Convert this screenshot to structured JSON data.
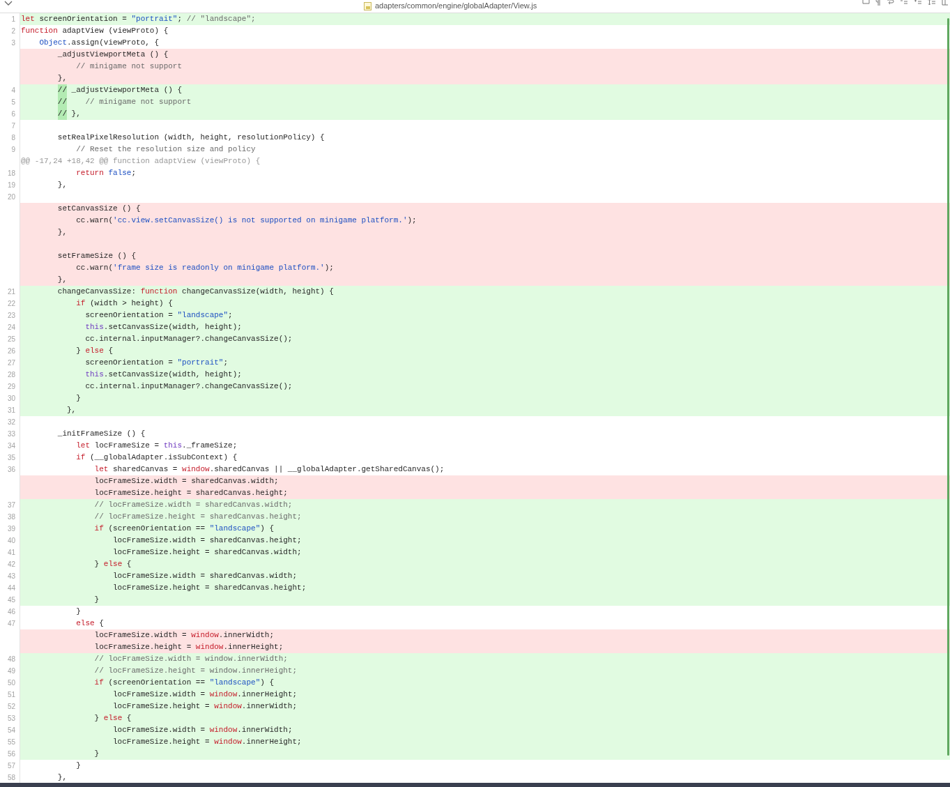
{
  "header": {
    "file_path": "adapters/common/engine/globalAdapter/View.js"
  },
  "lines": [
    {
      "kind": "added",
      "number": "1",
      "tokens": [
        {
          "kind": "keyword",
          "text": "let"
        },
        {
          "kind": "plain",
          "text": " screenOrientation = "
        },
        {
          "kind": "string",
          "text": "\"portrait\""
        },
        {
          "kind": "plain",
          "text": "; "
        },
        {
          "kind": "comment",
          "text": "// \"landscape\";"
        }
      ]
    },
    {
      "kind": "context",
      "number": "2",
      "tokens": [
        {
          "kind": "keyword",
          "text": "function"
        },
        {
          "kind": "plain",
          "text": " adaptView (viewProto) {"
        }
      ]
    },
    {
      "kind": "context",
      "number": "3",
      "tokens": [
        {
          "kind": "builtin",
          "text": "    Object"
        },
        {
          "kind": "plain",
          "text": ".assign(viewProto, {"
        }
      ]
    },
    {
      "kind": "removed",
      "tokens": [
        {
          "kind": "plain",
          "text": "        _adjustViewportMeta () {"
        }
      ]
    },
    {
      "kind": "removed",
      "tokens": [
        {
          "kind": "comment",
          "text": "            // minigame not support"
        }
      ]
    },
    {
      "kind": "removed",
      "tokens": [
        {
          "kind": "plain",
          "text": "        },"
        }
      ]
    },
    {
      "kind": "added",
      "number": "4",
      "tokens": [
        {
          "kind": "marked",
          "text": "        //"
        },
        {
          "kind": "plain",
          "text": " _adjustViewportMeta () {"
        }
      ]
    },
    {
      "kind": "added",
      "number": "5",
      "tokens": [
        {
          "kind": "marked",
          "text": "        //"
        },
        {
          "kind": "comment",
          "text": "    // minigame not support"
        }
      ]
    },
    {
      "kind": "added",
      "number": "6",
      "tokens": [
        {
          "kind": "marked",
          "text": "        //"
        },
        {
          "kind": "plain",
          "text": " },"
        }
      ]
    },
    {
      "kind": "context",
      "number": "7"
    },
    {
      "kind": "context",
      "number": "8",
      "tokens": [
        {
          "kind": "plain",
          "text": "        setRealPixelResolution (width, height, resolutionPolicy) {"
        }
      ]
    },
    {
      "kind": "context",
      "number": "9",
      "tokens": [
        {
          "kind": "comment",
          "text": "            // Reset the resolution size and policy"
        }
      ]
    },
    {
      "kind": "hunk",
      "tokens": [
        {
          "kind": "plain",
          "text": "@@ -17,24 +18,42 @@ function adaptView (viewProto) {"
        }
      ]
    },
    {
      "kind": "context",
      "number": "18",
      "tokens": [
        {
          "kind": "keyword",
          "text": "            return"
        },
        {
          "kind": "builtin",
          "text": " false"
        },
        {
          "kind": "plain",
          "text": ";"
        }
      ]
    },
    {
      "kind": "context",
      "number": "19",
      "tokens": [
        {
          "kind": "plain",
          "text": "        },"
        }
      ]
    },
    {
      "kind": "context",
      "number": "20"
    },
    {
      "kind": "removed",
      "tokens": [
        {
          "kind": "plain",
          "text": "        setCanvasSize () {"
        }
      ]
    },
    {
      "kind": "removed",
      "tokens": [
        {
          "kind": "plain",
          "text": "            cc.warn("
        },
        {
          "kind": "string",
          "text": "'cc.view.setCanvasSize() is not supported on minigame platform.'"
        },
        {
          "kind": "plain",
          "text": ");"
        }
      ]
    },
    {
      "kind": "removed",
      "tokens": [
        {
          "kind": "plain",
          "text": "        },"
        }
      ]
    },
    {
      "kind": "removed"
    },
    {
      "kind": "removed",
      "tokens": [
        {
          "kind": "plain",
          "text": "        setFrameSize () {"
        }
      ]
    },
    {
      "kind": "removed",
      "tokens": [
        {
          "kind": "plain",
          "text": "            cc.warn("
        },
        {
          "kind": "string",
          "text": "'frame size is readonly on minigame platform.'"
        },
        {
          "kind": "plain",
          "text": ");"
        }
      ]
    },
    {
      "kind": "removed",
      "tokens": [
        {
          "kind": "plain",
          "text": "        },"
        }
      ]
    },
    {
      "kind": "added",
      "number": "21",
      "tokens": [
        {
          "kind": "plain",
          "text": "        changeCanvasSize: "
        },
        {
          "kind": "keyword",
          "text": "function"
        },
        {
          "kind": "plain",
          "text": " changeCanvasSize(width, height) {"
        }
      ]
    },
    {
      "kind": "added",
      "number": "22",
      "tokens": [
        {
          "kind": "keyword",
          "text": "            if"
        },
        {
          "kind": "plain",
          "text": " (width > height) {"
        }
      ]
    },
    {
      "kind": "added",
      "number": "23",
      "tokens": [
        {
          "kind": "plain",
          "text": "              screenOrientation = "
        },
        {
          "kind": "string",
          "text": "\"landscape\""
        },
        {
          "kind": "plain",
          "text": ";"
        }
      ]
    },
    {
      "kind": "added",
      "number": "24",
      "tokens": [
        {
          "kind": "self",
          "text": "              this"
        },
        {
          "kind": "plain",
          "text": ".setCanvasSize(width, height);"
        }
      ]
    },
    {
      "kind": "added",
      "number": "25",
      "tokens": [
        {
          "kind": "plain",
          "text": "              cc.internal.inputManager?.changeCanvasSize();"
        }
      ]
    },
    {
      "kind": "added",
      "number": "26",
      "tokens": [
        {
          "kind": "plain",
          "text": "            } "
        },
        {
          "kind": "keyword",
          "text": "else"
        },
        {
          "kind": "plain",
          "text": " {"
        }
      ]
    },
    {
      "kind": "added",
      "number": "27",
      "tokens": [
        {
          "kind": "plain",
          "text": "              screenOrientation = "
        },
        {
          "kind": "string",
          "text": "\"portrait\""
        },
        {
          "kind": "plain",
          "text": ";"
        }
      ]
    },
    {
      "kind": "added",
      "number": "28",
      "tokens": [
        {
          "kind": "self",
          "text": "              this"
        },
        {
          "kind": "plain",
          "text": ".setCanvasSize(width, height);"
        }
      ]
    },
    {
      "kind": "added",
      "number": "29",
      "tokens": [
        {
          "kind": "plain",
          "text": "              cc.internal.inputManager?.changeCanvasSize();"
        }
      ]
    },
    {
      "kind": "added",
      "number": "30",
      "tokens": [
        {
          "kind": "plain",
          "text": "            }"
        }
      ]
    },
    {
      "kind": "added",
      "number": "31",
      "tokens": [
        {
          "kind": "plain",
          "text": "          },"
        }
      ]
    },
    {
      "kind": "context",
      "number": "32"
    },
    {
      "kind": "context",
      "number": "33",
      "tokens": [
        {
          "kind": "plain",
          "text": "        _initFrameSize () {"
        }
      ]
    },
    {
      "kind": "context",
      "number": "34",
      "tokens": [
        {
          "kind": "keyword",
          "text": "            let"
        },
        {
          "kind": "plain",
          "text": " locFrameSize = "
        },
        {
          "kind": "self",
          "text": "this"
        },
        {
          "kind": "plain",
          "text": "._frameSize;"
        }
      ]
    },
    {
      "kind": "context",
      "number": "35",
      "tokens": [
        {
          "kind": "keyword",
          "text": "            if"
        },
        {
          "kind": "plain",
          "text": " (__globalAdapter.isSubContext) {"
        }
      ]
    },
    {
      "kind": "context",
      "number": "36",
      "tokens": [
        {
          "kind": "keyword",
          "text": "                let"
        },
        {
          "kind": "plain",
          "text": " sharedCanvas = "
        },
        {
          "kind": "keyword",
          "text": "window"
        },
        {
          "kind": "plain",
          "text": ".sharedCanvas || __globalAdapter.getSharedCanvas();"
        }
      ]
    },
    {
      "kind": "removed",
      "tokens": [
        {
          "kind": "plain",
          "text": "                locFrameSize.width = sharedCanvas.width;"
        }
      ]
    },
    {
      "kind": "removed",
      "tokens": [
        {
          "kind": "plain",
          "text": "                locFrameSize.height = sharedCanvas.height;"
        }
      ]
    },
    {
      "kind": "added",
      "number": "37",
      "tokens": [
        {
          "kind": "comment",
          "text": "                // locFrameSize.width = sharedCanvas.width;"
        }
      ]
    },
    {
      "kind": "added",
      "number": "38",
      "tokens": [
        {
          "kind": "comment",
          "text": "                // locFrameSize.height = sharedCanvas.height;"
        }
      ]
    },
    {
      "kind": "added",
      "number": "39",
      "tokens": [
        {
          "kind": "keyword",
          "text": "                if"
        },
        {
          "kind": "plain",
          "text": " (screenOrientation == "
        },
        {
          "kind": "string",
          "text": "\"landscape\""
        },
        {
          "kind": "plain",
          "text": ") {"
        }
      ]
    },
    {
      "kind": "added",
      "number": "40",
      "tokens": [
        {
          "kind": "plain",
          "text": "                    locFrameSize.width = sharedCanvas.height;"
        }
      ]
    },
    {
      "kind": "added",
      "number": "41",
      "tokens": [
        {
          "kind": "plain",
          "text": "                    locFrameSize.height = sharedCanvas.width;"
        }
      ]
    },
    {
      "kind": "added",
      "number": "42",
      "tokens": [
        {
          "kind": "plain",
          "text": "                } "
        },
        {
          "kind": "keyword",
          "text": "else"
        },
        {
          "kind": "plain",
          "text": " {"
        }
      ]
    },
    {
      "kind": "added",
      "number": "43",
      "tokens": [
        {
          "kind": "plain",
          "text": "                    locFrameSize.width = sharedCanvas.width;"
        }
      ]
    },
    {
      "kind": "added",
      "number": "44",
      "tokens": [
        {
          "kind": "plain",
          "text": "                    locFrameSize.height = sharedCanvas.height;"
        }
      ]
    },
    {
      "kind": "added",
      "number": "45",
      "tokens": [
        {
          "kind": "plain",
          "text": "                }"
        }
      ]
    },
    {
      "kind": "context",
      "number": "46",
      "tokens": [
        {
          "kind": "plain",
          "text": "            }"
        }
      ]
    },
    {
      "kind": "context",
      "number": "47",
      "tokens": [
        {
          "kind": "keyword",
          "text": "            else"
        },
        {
          "kind": "plain",
          "text": " {"
        }
      ]
    },
    {
      "kind": "removed",
      "tokens": [
        {
          "kind": "plain",
          "text": "                locFrameSize.width = "
        },
        {
          "kind": "keyword",
          "text": "window"
        },
        {
          "kind": "plain",
          "text": ".innerWidth;"
        }
      ]
    },
    {
      "kind": "removed",
      "tokens": [
        {
          "kind": "plain",
          "text": "                locFrameSize.height = "
        },
        {
          "kind": "keyword",
          "text": "window"
        },
        {
          "kind": "plain",
          "text": ".innerHeight;"
        }
      ]
    },
    {
      "kind": "added",
      "number": "48",
      "tokens": [
        {
          "kind": "comment",
          "text": "                // locFrameSize.width = window.innerWidth;"
        }
      ]
    },
    {
      "kind": "added",
      "number": "49",
      "tokens": [
        {
          "kind": "comment",
          "text": "                // locFrameSize.height = window.innerHeight;"
        }
      ]
    },
    {
      "kind": "added",
      "number": "50",
      "tokens": [
        {
          "kind": "keyword",
          "text": "                if"
        },
        {
          "kind": "plain",
          "text": " (screenOrientation == "
        },
        {
          "kind": "string",
          "text": "\"landscape\""
        },
        {
          "kind": "plain",
          "text": ") {"
        }
      ]
    },
    {
      "kind": "added",
      "number": "51",
      "tokens": [
        {
          "kind": "plain",
          "text": "                    locFrameSize.width = "
        },
        {
          "kind": "keyword",
          "text": "window"
        },
        {
          "kind": "plain",
          "text": ".innerHeight;"
        }
      ]
    },
    {
      "kind": "added",
      "number": "52",
      "tokens": [
        {
          "kind": "plain",
          "text": "                    locFrameSize.height = "
        },
        {
          "kind": "keyword",
          "text": "window"
        },
        {
          "kind": "plain",
          "text": ".innerWidth;"
        }
      ]
    },
    {
      "kind": "added",
      "number": "53",
      "tokens": [
        {
          "kind": "plain",
          "text": "                } "
        },
        {
          "kind": "keyword",
          "text": "else"
        },
        {
          "kind": "plain",
          "text": " {"
        }
      ]
    },
    {
      "kind": "added",
      "number": "54",
      "tokens": [
        {
          "kind": "plain",
          "text": "                    locFrameSize.width = "
        },
        {
          "kind": "keyword",
          "text": "window"
        },
        {
          "kind": "plain",
          "text": ".innerWidth;"
        }
      ]
    },
    {
      "kind": "added",
      "number": "55",
      "tokens": [
        {
          "kind": "plain",
          "text": "                    locFrameSize.height = "
        },
        {
          "kind": "keyword",
          "text": "window"
        },
        {
          "kind": "plain",
          "text": ".innerHeight;"
        }
      ]
    },
    {
      "kind": "added",
      "number": "56",
      "tokens": [
        {
          "kind": "plain",
          "text": "                }"
        }
      ]
    },
    {
      "kind": "context",
      "number": "57",
      "tokens": [
        {
          "kind": "plain",
          "text": "            }"
        }
      ]
    },
    {
      "kind": "context",
      "number": "58",
      "tokens": [
        {
          "kind": "plain",
          "text": "        },"
        }
      ]
    }
  ]
}
